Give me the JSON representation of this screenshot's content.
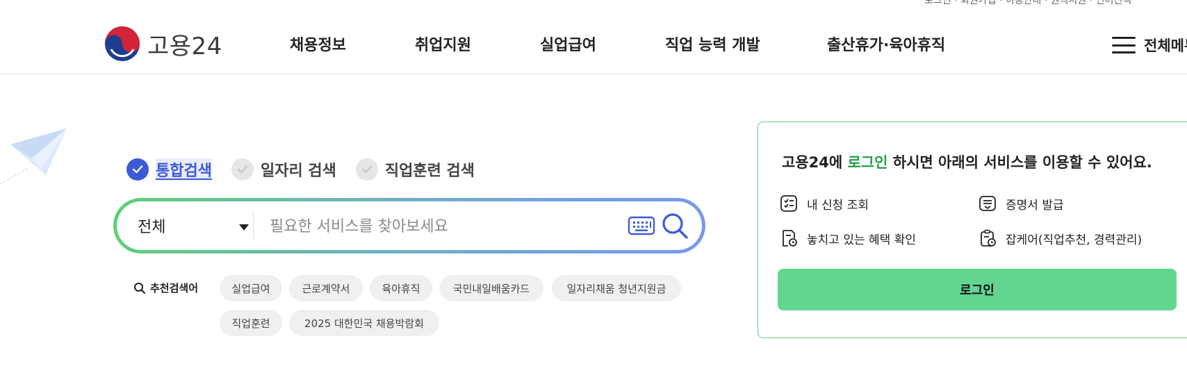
{
  "header": {
    "logo_text": "고용24",
    "nav": [
      "채용정보",
      "취업지원",
      "실업급여",
      "직업 능력 개발",
      "출산휴가·육아휴직"
    ],
    "menu_all_label": "전체메뉴",
    "util_links": "로그인 · 회원가입 · 이용안내 · 원격지원 · 언어선택"
  },
  "search": {
    "tabs": [
      {
        "label": "통합검색",
        "active": true
      },
      {
        "label": "일자리 검색",
        "active": false
      },
      {
        "label": "직업훈련 검색",
        "active": false
      }
    ],
    "category_value": "전체",
    "placeholder": "필요한 서비스를 찾아보세요",
    "recommended_label": "추천검색어",
    "recommended": [
      "실업급여",
      "근로계약서",
      "육아휴직",
      "국민내일배움카드",
      "일자리채움 청년지원금",
      "직업훈련",
      "2025 대한민국 채용박람회"
    ]
  },
  "login_card": {
    "title_prefix": "고용24에 ",
    "title_highlight": "로그인",
    "title_suffix": " 하시면 아래의 서비스를 이용할 수 있어요.",
    "services": [
      "내 신청 조회",
      "증명서 발급",
      "놓치고 있는 혜택 확인",
      "잡케어(직업추천, 경력관리)"
    ],
    "login_button": "로그인"
  },
  "colors": {
    "accent_blue": "#3d5ad6",
    "login_green": "#62d591",
    "highlight_green": "#20a04a"
  }
}
